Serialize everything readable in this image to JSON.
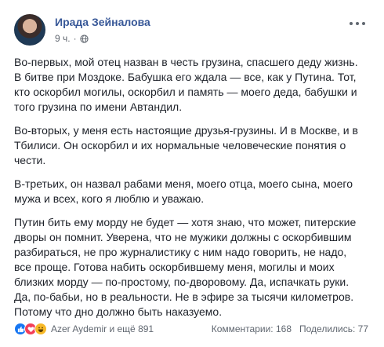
{
  "post": {
    "author": "Ирада Зейналова",
    "time": "9 ч.",
    "visibility_icon": "globe-icon",
    "paragraphs": [
      "Во-первых, мой отец назван в честь грузина, спасшего деду жизнь. В битве при Моздоке. Бабушка его ждала — все, как у Путина. Тот, кто оскорбил могилы, оскорбил и память — моего деда, бабушки и того грузина по имени Автандил.",
      "Во-вторых, у меня есть настоящие друзья-грузины. И в Москве, и в Тбилиси. Он оскорбил и их нормальные человеческие понятия о чести.",
      "В-третьих, он назвал рабами меня, моего отца, моего сына, моего мужа и всех, кого я люблю и уважаю.",
      "Путин бить ему морду не будет — хотя знаю, что может, питерские дворы он помнит. Уверена, что не мужики должны с оскорбившим разбираться, не про журналистику с ним надо говорить, не надо, все проще. Готова набить оскорбившему меня, могилы и моих близких морду — по-простому, по-дворовому. Да, испачкать руки. Да, по-бабьи, но в реальности. Не в эфире за тысячи километров. Потому что дно должно быть наказуемо."
    ]
  },
  "footer": {
    "reactions": [
      "like-icon",
      "love-icon",
      "haha-icon"
    ],
    "reactors": "Azer Aydemir и ещё 891",
    "comments": "Комментарии: 168",
    "shares": "Поделились: 77"
  },
  "colors": {
    "author": "#385898",
    "text": "#1d2129",
    "meta": "#616770",
    "like": "#1877f2",
    "love": "#f33e58",
    "haha": "#f7b928"
  }
}
